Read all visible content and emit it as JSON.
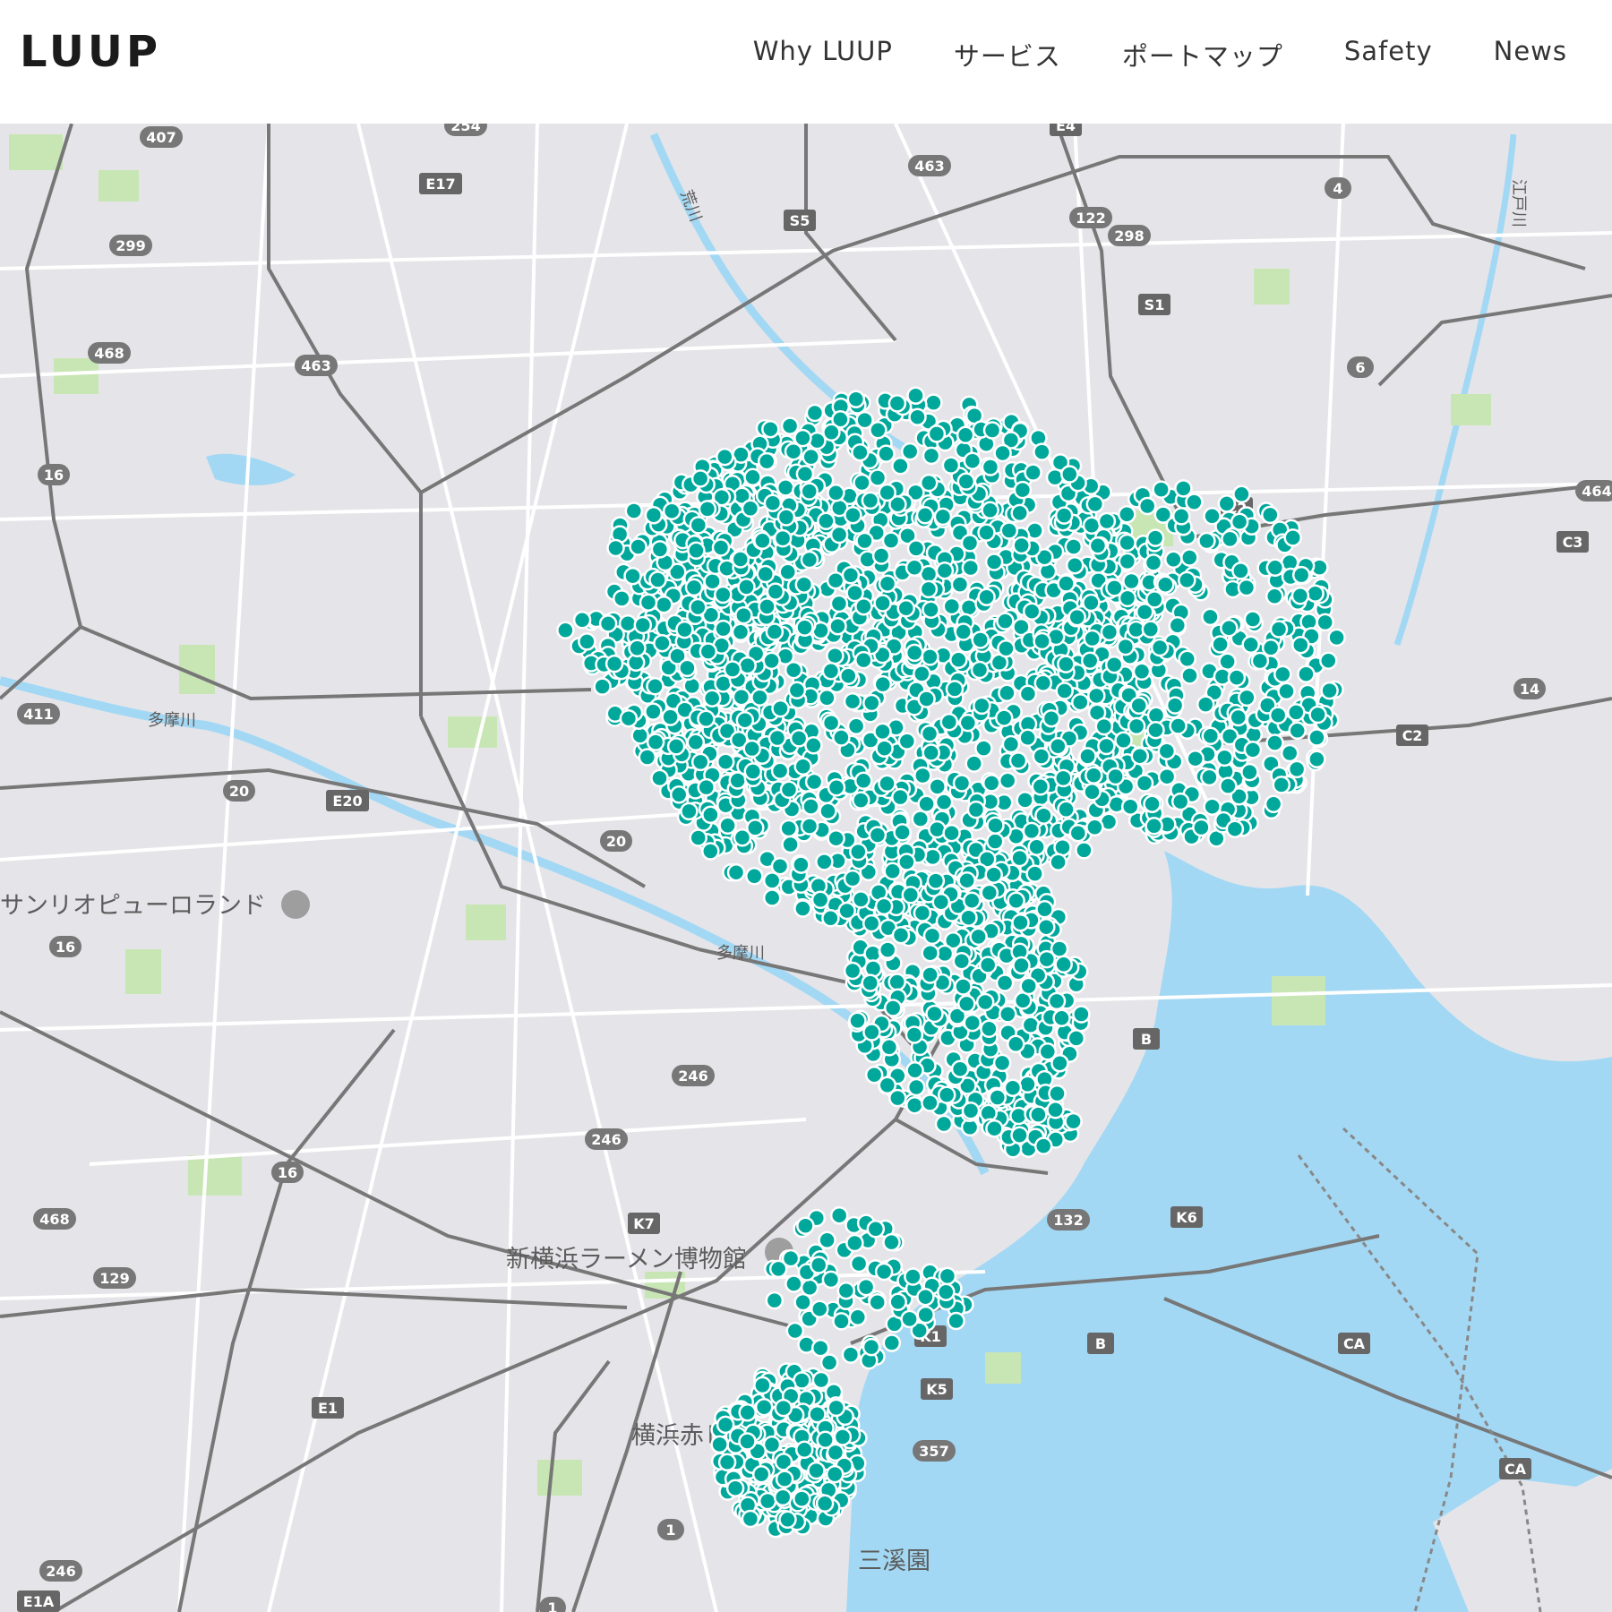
{
  "header": {
    "logo": "LUUP",
    "nav": [
      "Why LUUP",
      "サービス",
      "ポートマップ",
      "Safety",
      "News"
    ]
  },
  "map": {
    "colors": {
      "land": "#e5e5e9",
      "water": "#a3d8f4",
      "park": "#c8e6b4",
      "road_major": "#7a7a7a",
      "road_minor": "#ffffff",
      "port": "#00a89c"
    },
    "poi": [
      "サンリオピューロランド",
      "新横浜ラーメン博物館",
      "横浜赤レン",
      "三溪園"
    ],
    "rivers": [
      "多摩川",
      "多摩川",
      "荒川",
      "江戸川"
    ],
    "shields": [
      "407",
      "254",
      "E4",
      "463",
      "E17",
      "S5",
      "122",
      "298",
      "4",
      "299",
      "S1",
      "6",
      "468",
      "463",
      "16",
      "C2",
      "464",
      "C3",
      "411",
      "14",
      "C2",
      "20",
      "E20",
      "20",
      "16",
      "B",
      "246",
      "246",
      "16",
      "K7",
      "132",
      "K6",
      "468",
      "129",
      "K1",
      "B",
      "CA",
      "E1",
      "K5",
      "357",
      "CA",
      "1",
      "246",
      "E1A",
      "1"
    ]
  }
}
